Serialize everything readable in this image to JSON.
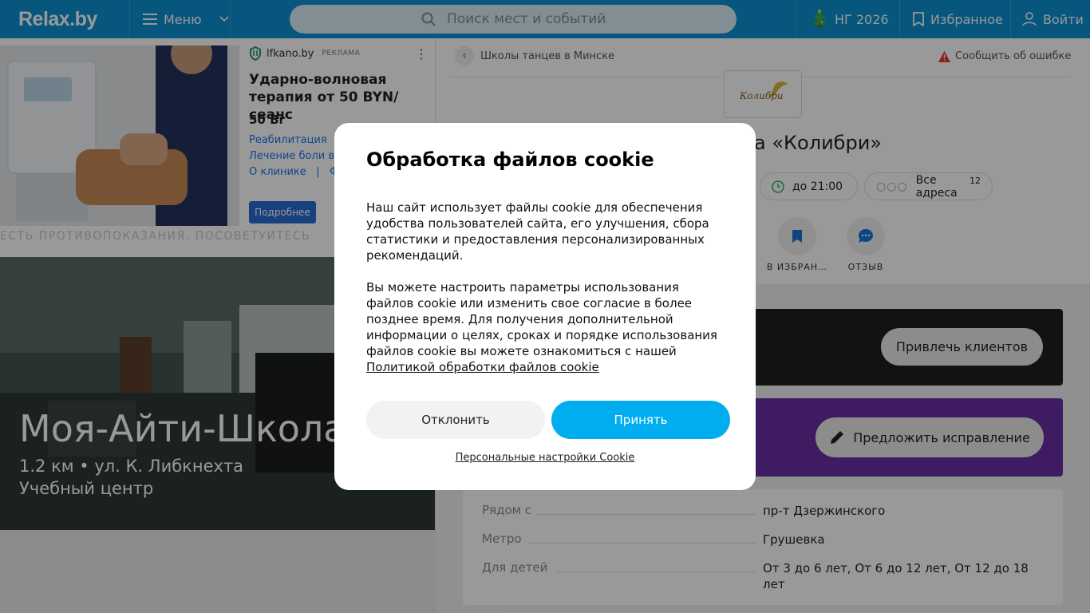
{
  "header": {
    "logo": "Relax.by",
    "menu_label": "Меню",
    "search_placeholder": "Поиск мест и событий",
    "ng_label": "НГ 2026",
    "favorites_label": "Избранное",
    "login_label": "Войти"
  },
  "ad": {
    "brand": "lfkano.by",
    "tag": "РЕКЛАМА",
    "title": "Ударно-волновая терапия от 50 BYN/сеанс",
    "price": "50 Br",
    "links": [
      "Реабилитация",
      "Лечение боли в сп",
      "О клинике   |   Фи"
    ],
    "button": "Подробнее",
    "disclaimer": "ЕСТЬ ПРОТИВОПОКАЗАНИЯ. ПОСОВЕТУЙТЕСЬ"
  },
  "hero": {
    "title": "Моя-Айти-Школа",
    "distance": "1.2 км • ул. К. Либкнехта",
    "category": "Учебный центр"
  },
  "place": {
    "breadcrumb": "Школы танцев в Минске",
    "report": "Сообщить об ошибке",
    "logo_text": "Колибри",
    "title": "а «Колибри»",
    "hours": "до 21:00",
    "addresses": "Все адреса",
    "addresses_count": "12",
    "actions": [
      {
        "label": "В ИЗБРАН…",
        "icon": "bookmark-icon"
      },
      {
        "label": "ОТЗЫВ",
        "icon": "comment-icon"
      }
    ],
    "attract_button": "Привлечь клиентов",
    "suggest_button": "Предложить исправление",
    "info": [
      {
        "label": "Рядом с",
        "value": "пр-т Дзержинского"
      },
      {
        "label": "Метро",
        "value": "Грушевка"
      },
      {
        "label": "Для детей",
        "value": "От 3 до 6 лет, От 6 до 12 лет, От 12 до 18 лет"
      }
    ]
  },
  "cookie": {
    "title": "Обработка файлов cookie",
    "para1": "Наш сайт использует файлы cookie для обеспечения удобства пользователей сайта, его улучшения, сбора статистики и предоставления персонализированных рекомендаций.",
    "para2": "Вы можете настроить параметры использования файлов cookie или изменить свое согласие в более позднее время. Для получения дополнительной информации о целях, сроках и порядке использования файлов cookie вы можете ознакомиться с нашей",
    "policy_link": "Политикой обработки файлов cookie",
    "decline": "Отклонить",
    "accept": "Принять",
    "personal": "Персональные настройки Cookie"
  },
  "colors": {
    "header": "#0b8fd3",
    "accept": "#00aeef",
    "purple": "#6a2fa3"
  }
}
